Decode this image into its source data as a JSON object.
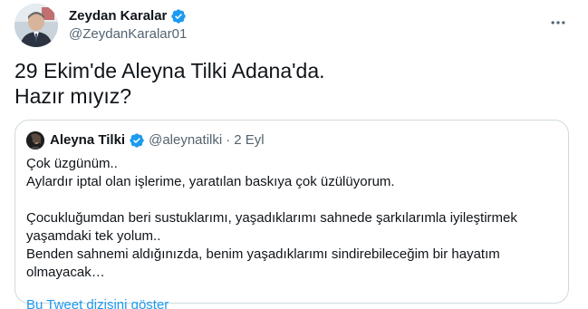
{
  "author": {
    "display_name": "Zeydan Karalar",
    "handle": "@ZeydanKaralar01",
    "verified": true
  },
  "tweet": {
    "text": "29 Ekim'de Aleyna Tilki Adana'da.\nHazır mıyız?"
  },
  "quoted_tweet": {
    "display_name": "Aleyna Tilki",
    "handle": "@aleynatilki",
    "separator": "·",
    "date": "2 Eyl",
    "verified": true,
    "lines": {
      "l1": "Çok üzgünüm..",
      "l2": "Aylardır iptal olan işlerime, yaratılan baskıya çok üzülüyorum.",
      "l3": "Çocukluğumdan beri sustuklarımı, yaşadıklarımı sahnede şarkılarımla iyileştirmek",
      "l4": "yaşamdaki tek yolum..",
      "l5": "Benden sahnemi aldığınızda, benim yaşadıklarımı sindirebileceğim bir hayatım",
      "l6": "olmayacak…"
    },
    "show_thread_label": "Bu Tweet dizisini göster"
  },
  "colors": {
    "accent": "#1d9bf0",
    "text_primary": "#0f1419",
    "text_secondary": "#536471",
    "border": "#cfd9de"
  },
  "icons": {
    "verified": "verified-badge-icon",
    "more": "more-options-icon"
  }
}
